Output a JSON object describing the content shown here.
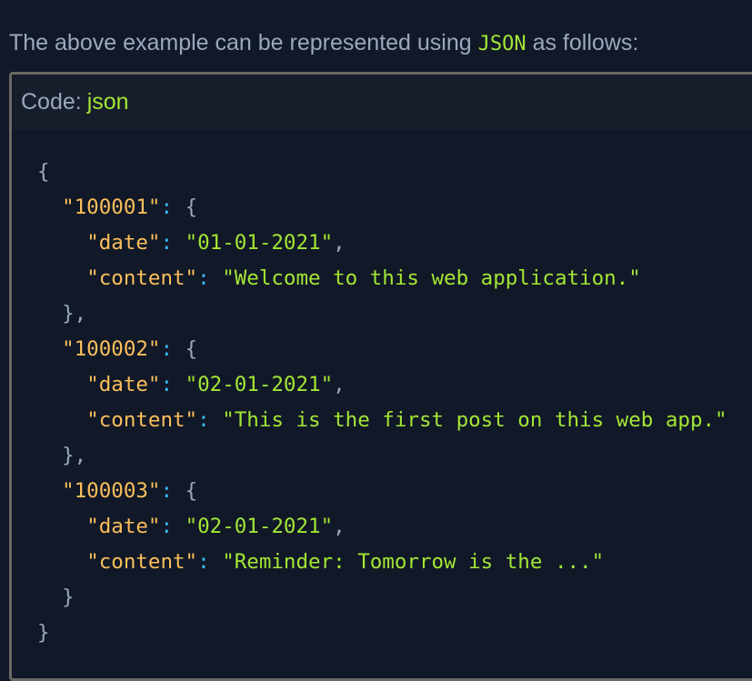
{
  "intro": {
    "before": "The above example can be represented using",
    "code": "JSON",
    "after": "as follows:"
  },
  "code_block": {
    "header_label": "Code:",
    "language": "json",
    "entries": [
      {
        "id": "\"100001\"",
        "date_key": "\"date\"",
        "date": "\"01-01-2021\"",
        "content_key": "\"content\"",
        "content": "\"Welcome to this web application.\""
      },
      {
        "id": "\"100002\"",
        "date_key": "\"date\"",
        "date": "\"02-01-2021\"",
        "content_key": "\"content\"",
        "content": "\"This is the first post on this web app.\""
      },
      {
        "id": "\"100003\"",
        "date_key": "\"date\"",
        "date": "\"02-01-2021\"",
        "content_key": "\"content\"",
        "content": "\"Reminder: Tomorrow is the ...\""
      }
    ]
  }
}
